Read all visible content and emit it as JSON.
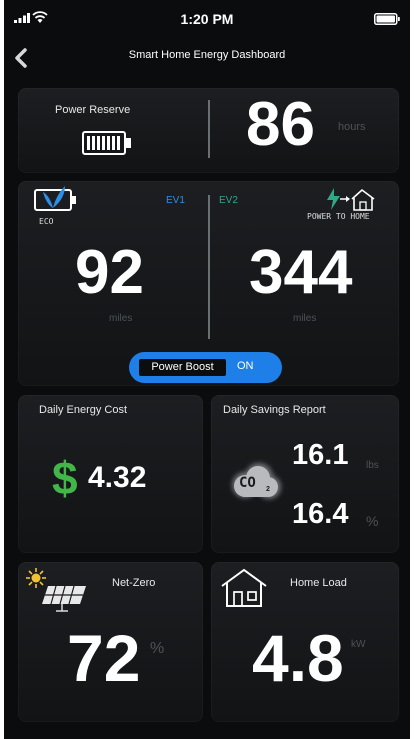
{
  "status": {
    "time": "1:20 PM"
  },
  "nav": {
    "title": "Smart Home Energy Dashboard"
  },
  "reserve": {
    "label": "Power Reserve",
    "value": "86",
    "unit": "hours"
  },
  "ev": {
    "ev1_label": "EV1",
    "ev2_label": "EV2",
    "eco_label": "ECO",
    "p2h_label": "POWER TO HOME",
    "ev1_value": "92",
    "ev1_unit": "miles",
    "ev2_value": "344",
    "ev2_unit": "miles"
  },
  "boost": {
    "label": "Power Boost",
    "state": "ON"
  },
  "cost": {
    "label": "Daily Energy Cost",
    "symbol": "$",
    "value": "4.32"
  },
  "savings": {
    "label": "Daily Savings Report",
    "co2_value": "16.1",
    "co2_unit": "lbs",
    "pct_value": "16.4",
    "pct_unit": "%",
    "co2_icon_text": "CO"
  },
  "netzero": {
    "label": "Net-Zero",
    "value": "72",
    "unit": "%"
  },
  "homeload": {
    "label": "Home Load",
    "value": "4.8",
    "unit": "kW"
  },
  "colors": {
    "accent_blue": "#1f7fe8",
    "eco_blue": "#2f8fe6",
    "ev2_green": "#2fa88a",
    "dollar_green": "#43b649"
  }
}
